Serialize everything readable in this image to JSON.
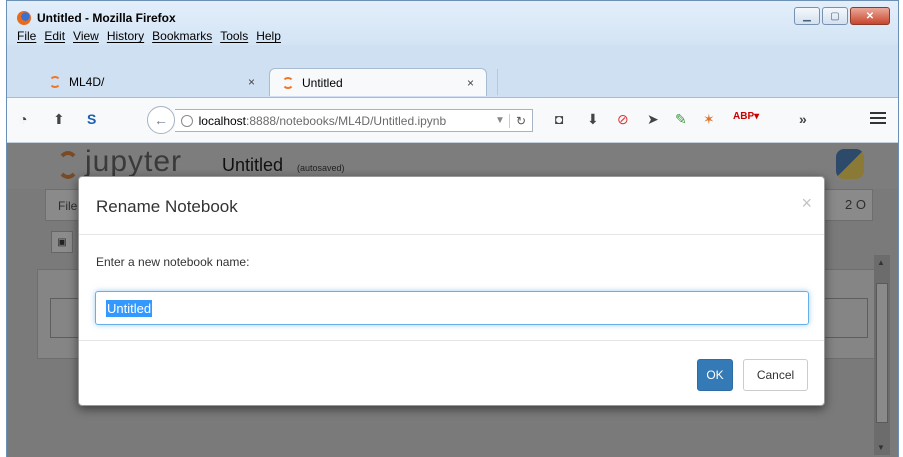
{
  "window": {
    "title": "Untitled - Mozilla Firefox"
  },
  "menu": [
    "File",
    "Edit",
    "View",
    "History",
    "Bookmarks",
    "Tools",
    "Help"
  ],
  "tabs": [
    {
      "label": "ML4D/",
      "active": false
    },
    {
      "label": "Untitled",
      "active": true
    }
  ],
  "tab_close_glyph": "×",
  "url": {
    "host": "localhost",
    "rest": ":8888/notebooks/ML4D/Untitled.ipynb"
  },
  "overflow_glyph": "»",
  "jupyter": {
    "wordmark": "jupyter",
    "notebook_name": "Untitled",
    "autosave_status": "(autosaved)",
    "menu_visible": "File",
    "kernel_indicator": "2 O"
  },
  "modal": {
    "title": "Rename Notebook",
    "close_glyph": "×",
    "prompt": "Enter a new notebook name:",
    "input_value": "Untitled",
    "ok_label": "OK",
    "cancel_label": "Cancel"
  },
  "colors": {
    "accent": "#337ab7",
    "selection": "#3399ff",
    "focus_ring": "#66afe9"
  }
}
